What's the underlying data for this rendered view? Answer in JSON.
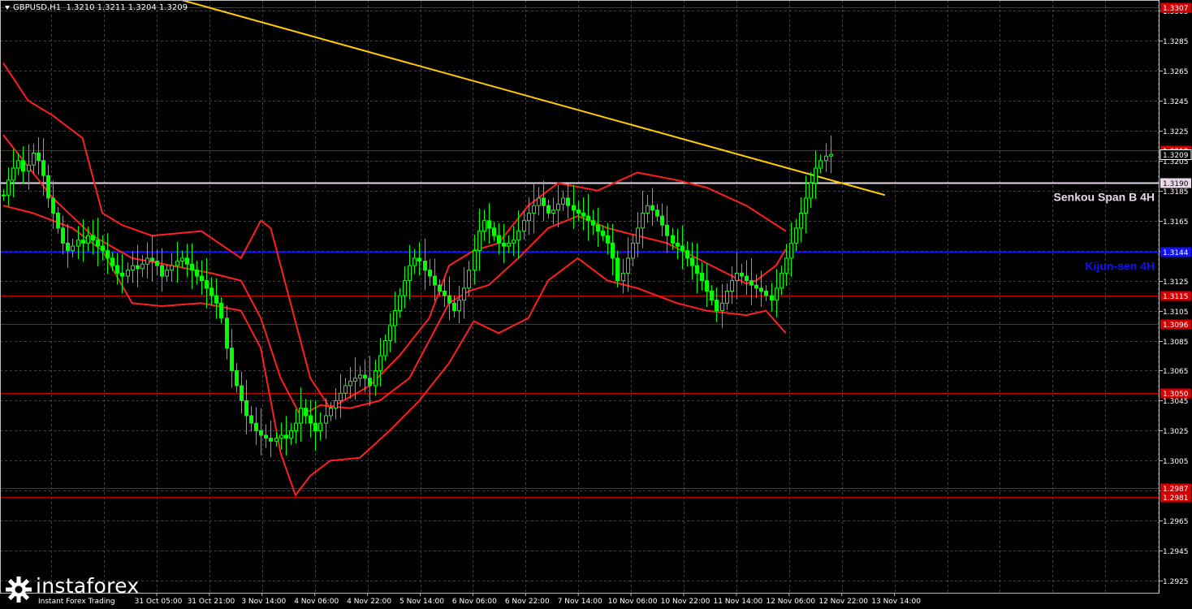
{
  "header": {
    "symbol": "GBPUSD,H1",
    "ohlc": "1.3210 1.3211 1.3204 1.3209"
  },
  "watermark": {
    "brand": "instaforex",
    "tagline": "Instant Forex Trading"
  },
  "colors": {
    "background": "#000000",
    "grid": "#434343",
    "bull_candle": "#00ff00",
    "ichimoku_lines": "#ff1f1f",
    "trendline": "#ffcc00",
    "kijun_sen": "#1010ff",
    "senkou_span_b": "#e8d8e8",
    "level_lines": "#c40000",
    "level_label_bg": "#d00000",
    "axis_text": "#ffffff"
  },
  "chart_data": {
    "type": "line",
    "instrument": "GBPUSD",
    "timeframe": "H1",
    "ylim": [
      1.2917,
      1.3312
    ],
    "y_ticks": [
      "1.3305",
      "1.3285",
      "1.3265",
      "1.3245",
      "1.3225",
      "1.3205",
      "1.3185",
      "1.3165",
      "1.3145",
      "1.3125",
      "1.3105",
      "1.3085",
      "1.3065",
      "1.3045",
      "1.3025",
      "1.3005",
      "1.2985",
      "1.2965",
      "1.2945",
      "1.2925"
    ],
    "x_tick_labels": [
      "31 Oct 05:00",
      "31 Oct 21:00",
      "3 Nov 14:00",
      "4 Nov 06:00",
      "4 Nov 22:00",
      "5 Nov 14:00",
      "6 Nov 06:00",
      "6 Nov 22:00",
      "7 Nov 14:00",
      "10 Nov 06:00",
      "10 Nov 22:00",
      "11 Nov 14:00",
      "12 Nov 06:00",
      "12 Nov 22:00",
      "13 Nov 14:00"
    ],
    "bar_count": 172,
    "price_series": [
      1.3182,
      1.3192,
      1.32,
      1.3205,
      1.3198,
      1.3202,
      1.321,
      1.3205,
      1.3195,
      1.318,
      1.317,
      1.316,
      1.315,
      1.3145,
      1.3148,
      1.3152,
      1.315,
      1.3155,
      1.3152,
      1.3148,
      1.3145,
      1.314,
      1.3135,
      1.313,
      1.3128,
      1.3132,
      1.3135,
      1.3133,
      1.3136,
      1.314,
      1.3138,
      1.3135,
      1.3128,
      1.3132,
      1.3135,
      1.3138,
      1.314,
      1.3136,
      1.3132,
      1.3128,
      1.3125,
      1.312,
      1.3115,
      1.311,
      1.31,
      1.308,
      1.3065,
      1.3055,
      1.3045,
      1.3035,
      1.303,
      1.3025,
      1.3022,
      1.302,
      1.3018,
      1.302,
      1.3022,
      1.302,
      1.3025,
      1.303,
      1.304,
      1.3035,
      1.303,
      1.3025,
      1.303,
      1.3035,
      1.304,
      1.3045,
      1.305,
      1.3055,
      1.3058,
      1.306,
      1.3062,
      1.306,
      1.3055,
      1.3065,
      1.3075,
      1.3085,
      1.3095,
      1.3105,
      1.3115,
      1.3125,
      1.3135,
      1.314,
      1.3138,
      1.3132,
      1.3128,
      1.3122,
      1.3118,
      1.3115,
      1.311,
      1.3105,
      1.3112,
      1.312,
      1.3132,
      1.3145,
      1.3158,
      1.3165,
      1.316,
      1.3155,
      1.315,
      1.3148,
      1.315,
      1.3152,
      1.3158,
      1.3165,
      1.317,
      1.3175,
      1.318,
      1.3175,
      1.317,
      1.3172,
      1.3176,
      1.318,
      1.3175,
      1.3172,
      1.317,
      1.3168,
      1.3165,
      1.3162,
      1.3158,
      1.3155,
      1.315,
      1.314,
      1.3125,
      1.313,
      1.314,
      1.315,
      1.316,
      1.317,
      1.3175,
      1.3172,
      1.3168,
      1.3162,
      1.3155,
      1.315,
      1.3148,
      1.3145,
      1.314,
      1.3135,
      1.313,
      1.3125,
      1.3118,
      1.3112,
      1.3105,
      1.311,
      1.3118,
      1.3125,
      1.313,
      1.3128,
      1.3125,
      1.3122,
      1.312,
      1.3118,
      1.3115,
      1.3112,
      1.312,
      1.313,
      1.314,
      1.315,
      1.316,
      1.317,
      1.318,
      1.319,
      1.32,
      1.3205,
      1.3208,
      1.3209
    ],
    "indicator_lines": {
      "upper_band": [
        {
          "x": 0,
          "y": 1.327
        },
        {
          "x": 5,
          "y": 1.3245
        },
        {
          "x": 10,
          "y": 1.3235
        },
        {
          "x": 16,
          "y": 1.322
        },
        {
          "x": 20,
          "y": 1.317
        },
        {
          "x": 24,
          "y": 1.3162
        },
        {
          "x": 30,
          "y": 1.3155
        },
        {
          "x": 40,
          "y": 1.3158
        },
        {
          "x": 48,
          "y": 1.314
        },
        {
          "x": 52,
          "y": 1.3165
        },
        {
          "x": 54,
          "y": 1.316
        },
        {
          "x": 58,
          "y": 1.311
        },
        {
          "x": 62,
          "y": 1.306
        },
        {
          "x": 66,
          "y": 1.304
        },
        {
          "x": 74,
          "y": 1.3055
        },
        {
          "x": 80,
          "y": 1.3075
        },
        {
          "x": 86,
          "y": 1.31
        },
        {
          "x": 90,
          "y": 1.3135
        },
        {
          "x": 95,
          "y": 1.3145
        },
        {
          "x": 100,
          "y": 1.315
        },
        {
          "x": 106,
          "y": 1.3175
        },
        {
          "x": 112,
          "y": 1.319
        },
        {
          "x": 120,
          "y": 1.3185
        },
        {
          "x": 128,
          "y": 1.3197
        },
        {
          "x": 136,
          "y": 1.3192
        },
        {
          "x": 142,
          "y": 1.3187
        },
        {
          "x": 150,
          "y": 1.3175
        },
        {
          "x": 158,
          "y": 1.3158
        }
      ],
      "lower_band": [
        {
          "x": 0,
          "y": 1.3175
        },
        {
          "x": 6,
          "y": 1.317
        },
        {
          "x": 14,
          "y": 1.316
        },
        {
          "x": 20,
          "y": 1.3145
        },
        {
          "x": 26,
          "y": 1.311
        },
        {
          "x": 32,
          "y": 1.3108
        },
        {
          "x": 40,
          "y": 1.311
        },
        {
          "x": 48,
          "y": 1.3105
        },
        {
          "x": 52,
          "y": 1.308
        },
        {
          "x": 56,
          "y": 1.301
        },
        {
          "x": 59,
          "y": 1.2982
        },
        {
          "x": 62,
          "y": 1.2995
        },
        {
          "x": 66,
          "y": 1.3005
        },
        {
          "x": 72,
          "y": 1.3007
        },
        {
          "x": 78,
          "y": 1.3025
        },
        {
          "x": 84,
          "y": 1.3045
        },
        {
          "x": 90,
          "y": 1.307
        },
        {
          "x": 95,
          "y": 1.3098
        },
        {
          "x": 100,
          "y": 1.309
        },
        {
          "x": 106,
          "y": 1.31
        },
        {
          "x": 110,
          "y": 1.3125
        },
        {
          "x": 116,
          "y": 1.314
        },
        {
          "x": 122,
          "y": 1.3125
        },
        {
          "x": 128,
          "y": 1.312
        },
        {
          "x": 136,
          "y": 1.311
        },
        {
          "x": 142,
          "y": 1.3105
        },
        {
          "x": 150,
          "y": 1.3102
        },
        {
          "x": 154,
          "y": 1.3105
        },
        {
          "x": 158,
          "y": 1.309
        }
      ],
      "middle_line": [
        {
          "x": 0,
          "y": 1.3222
        },
        {
          "x": 10,
          "y": 1.318
        },
        {
          "x": 18,
          "y": 1.3155
        },
        {
          "x": 26,
          "y": 1.314
        },
        {
          "x": 34,
          "y": 1.3135
        },
        {
          "x": 42,
          "y": 1.313
        },
        {
          "x": 48,
          "y": 1.3125
        },
        {
          "x": 52,
          "y": 1.31
        },
        {
          "x": 56,
          "y": 1.306
        },
        {
          "x": 60,
          "y": 1.3035
        },
        {
          "x": 64,
          "y": 1.3042
        },
        {
          "x": 70,
          "y": 1.304
        },
        {
          "x": 76,
          "y": 1.3045
        },
        {
          "x": 82,
          "y": 1.306
        },
        {
          "x": 86,
          "y": 1.3085
        },
        {
          "x": 90,
          "y": 1.311
        },
        {
          "x": 94,
          "y": 1.3118
        },
        {
          "x": 98,
          "y": 1.3122
        },
        {
          "x": 104,
          "y": 1.314
        },
        {
          "x": 110,
          "y": 1.316
        },
        {
          "x": 116,
          "y": 1.3168
        },
        {
          "x": 122,
          "y": 1.316
        },
        {
          "x": 128,
          "y": 1.3155
        },
        {
          "x": 134,
          "y": 1.315
        },
        {
          "x": 140,
          "y": 1.314
        },
        {
          "x": 146,
          "y": 1.313
        },
        {
          "x": 150,
          "y": 1.3123
        },
        {
          "x": 152,
          "y": 1.3125
        },
        {
          "x": 156,
          "y": 1.3135
        },
        {
          "x": 158,
          "y": 1.3146
        }
      ]
    },
    "trendline": {
      "from": {
        "x": 36,
        "y": 1.3312
      },
      "to": {
        "x": 178,
        "y": 1.3182
      }
    },
    "horizontal_levels": [
      {
        "value": 1.3307,
        "label": "1.3307",
        "style": "red"
      },
      {
        "value": 1.3212,
        "label": "1.3212",
        "style": "red"
      },
      {
        "value": 1.319,
        "label": "1.3190",
        "style": "senkou"
      },
      {
        "value": 1.3144,
        "label": "1.3144",
        "style": "kijun"
      },
      {
        "value": 1.3115,
        "label": "1.3115",
        "style": "red"
      },
      {
        "value": 1.3096,
        "label": "1.3096",
        "style": "red"
      },
      {
        "value": 1.305,
        "label": "1.3050",
        "style": "red"
      },
      {
        "value": 1.2987,
        "label": "1.2987",
        "style": "red"
      },
      {
        "value": 1.2981,
        "label": "1.2981",
        "style": "red"
      }
    ],
    "current_price": {
      "value": 1.3209,
      "label": "1.3209"
    },
    "line_labels": [
      {
        "text": "Senkou Span B 4H",
        "level": 1.319,
        "color": "#e8d8e8"
      },
      {
        "text": "Kijun-sen 4H",
        "level": 1.3144,
        "color": "#1010ff"
      }
    ]
  }
}
